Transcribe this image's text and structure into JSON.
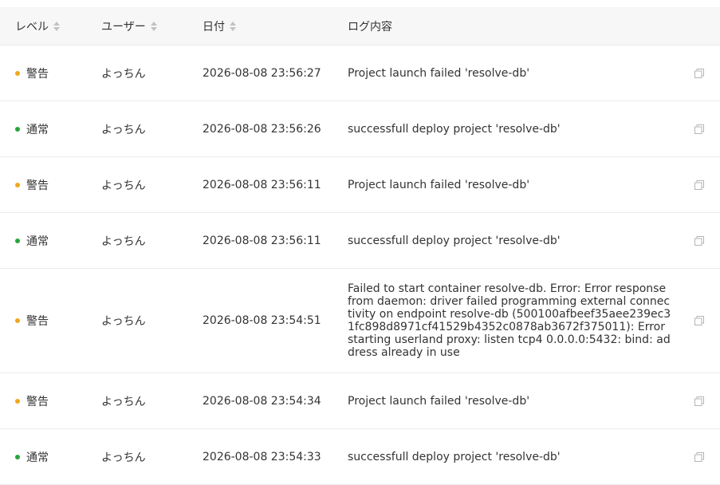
{
  "colors": {
    "warning": "#f0a71e",
    "normal": "#2aa43b",
    "header_bg": "#f7f7f7",
    "border": "#ebebeb"
  },
  "table": {
    "headers": {
      "level": "レベル",
      "user": "ユーザー",
      "date": "日付",
      "message": "ログ内容"
    },
    "rows": [
      {
        "level": "警告",
        "level_type": "warning",
        "user": "よっちん",
        "date": "2026-08-08 23:56:27",
        "message": "Project launch failed 'resolve-db'",
        "copy_icon": "copy-icon"
      },
      {
        "level": "通常",
        "level_type": "normal",
        "user": "よっちん",
        "date": "2026-08-08 23:56:26",
        "message": "successfull deploy project 'resolve-db'",
        "copy_icon": "copy-icon"
      },
      {
        "level": "警告",
        "level_type": "warning",
        "user": "よっちん",
        "date": "2026-08-08 23:56:11",
        "message": "Project launch failed 'resolve-db'",
        "copy_icon": "copy-icon"
      },
      {
        "level": "通常",
        "level_type": "normal",
        "user": "よっちん",
        "date": "2026-08-08 23:56:11",
        "message": "successfull deploy project 'resolve-db'",
        "copy_icon": "copy-icon"
      },
      {
        "level": "警告",
        "level_type": "warning",
        "user": "よっちん",
        "date": "2026-08-08 23:54:51",
        "message": "Failed to start container resolve-db. Error: Error response from daemon: driver failed programming external connectivity on endpoint resolve-db (500100afbeef35aee239ec31fc898d8971cf41529b4352c0878ab3672f375011): Error starting userland proxy: listen tcp4 0.0.0.0:5432: bind: address already in use",
        "copy_icon": "copy-icon"
      },
      {
        "level": "警告",
        "level_type": "warning",
        "user": "よっちん",
        "date": "2026-08-08 23:54:34",
        "message": "Project launch failed 'resolve-db'",
        "copy_icon": "copy-icon"
      },
      {
        "level": "通常",
        "level_type": "normal",
        "user": "よっちん",
        "date": "2026-08-08 23:54:33",
        "message": "successfull deploy project 'resolve-db'",
        "copy_icon": "copy-icon"
      }
    ]
  }
}
